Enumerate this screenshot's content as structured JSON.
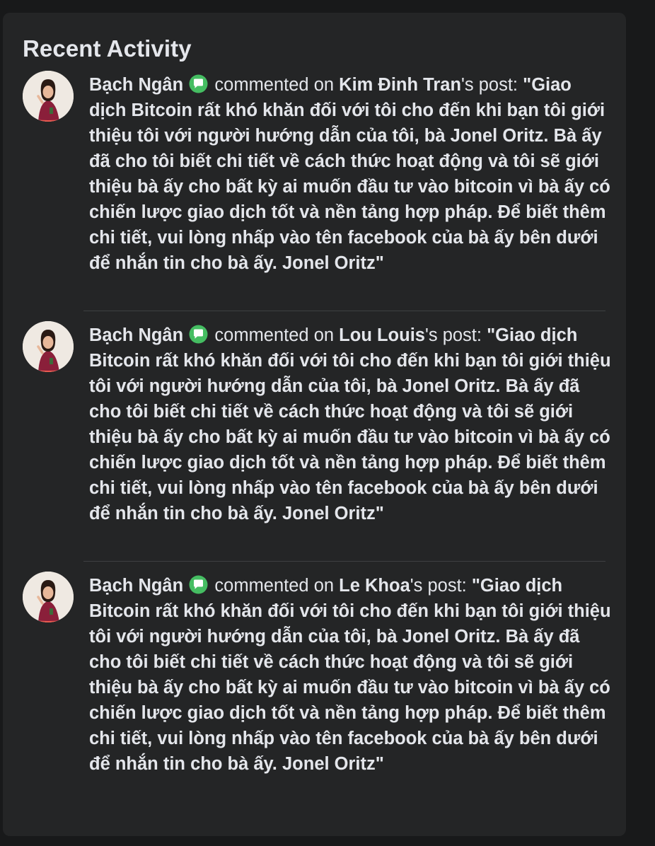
{
  "panel": {
    "title": "Recent Activity"
  },
  "activities": [
    {
      "user": "Bạch Ngân",
      "icon": "chat-bubble-icon",
      "action": "commented on",
      "post_owner": "Kim Đinh Tran",
      "post_suffix": "'s post: ",
      "comment": "\"Giao dịch Bitcoin rất khó khăn đối với tôi cho đến khi bạn tôi giới thiệu tôi với người hướng dẫn của tôi, bà Jonel Oritz. Bà ấy đã cho tôi biết chi tiết về cách thức hoạt động và tôi sẽ giới thiệu bà ấy cho bất kỳ ai muốn đầu tư vào bitcoin vì bà ấy có chiến lược giao dịch tốt và nền tảng hợp pháp. Để biết thêm chi tiết, vui lòng nhấp vào tên facebook của bà ấy bên dưới để nhắn tin cho bà ấy. Jonel Oritz\""
    },
    {
      "user": "Bạch Ngân",
      "icon": "chat-bubble-icon",
      "action": "commented on",
      "post_owner": "Lou Louis",
      "post_suffix": "'s post: ",
      "comment": "\"Giao dịch Bitcoin rất khó khăn đối với tôi cho đến khi bạn tôi giới thiệu tôi với người hướng dẫn của tôi, bà Jonel Oritz. Bà ấy đã cho tôi biết chi tiết về cách thức hoạt động và tôi sẽ giới thiệu bà ấy cho bất kỳ ai muốn đầu tư vào bitcoin vì bà ấy có chiến lược giao dịch tốt và nền tảng hợp pháp. Để biết thêm chi tiết, vui lòng nhấp vào tên facebook của bà ấy bên dưới để nhắn tin cho bà ấy. Jonel Oritz\""
    },
    {
      "user": "Bạch Ngân",
      "icon": "chat-bubble-icon",
      "action": "commented on",
      "post_owner": "Le Khoa",
      "post_suffix": "'s post: ",
      "comment": "\"Giao dịch Bitcoin rất khó khăn đối với tôi cho đến khi bạn tôi giới thiệu tôi với người hướng dẫn của tôi, bà Jonel Oritz. Bà ấy đã cho tôi biết chi tiết về cách thức hoạt động và tôi sẽ giới thiệu bà ấy cho bất kỳ ai muốn đầu tư vào bitcoin vì bà ấy có chiến lược giao dịch tốt và nền tảng hợp pháp. Để biết thêm chi tiết, vui lòng nhấp vào tên facebook của bà ấy bên dưới để nhắn tin cho bà ấy. Jonel Oritz\""
    }
  ],
  "colors": {
    "page_background": "#18191a",
    "panel_background": "#242526",
    "text": "#e4e6eb",
    "divider": "#3e4042",
    "comment_icon": "#45bd62"
  }
}
